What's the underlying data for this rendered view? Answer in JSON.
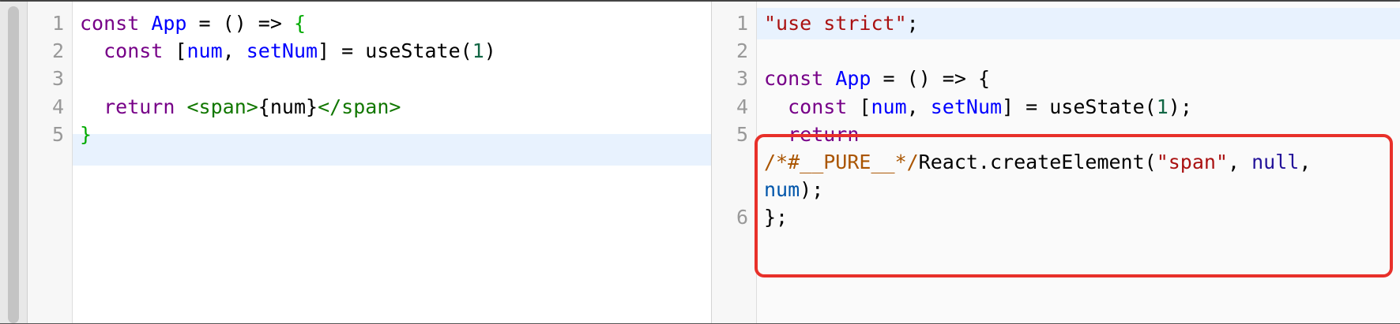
{
  "left_editor": {
    "lines": [
      {
        "n": "1",
        "tokens": [
          {
            "t": "const",
            "c": "kw"
          },
          {
            "t": " ",
            "c": "plain"
          },
          {
            "t": "App",
            "c": "def"
          },
          {
            "t": " = () => ",
            "c": "plain"
          },
          {
            "t": "{",
            "c": "br"
          }
        ]
      },
      {
        "n": "2",
        "tokens": [
          {
            "t": "  const",
            "c": "kw"
          },
          {
            "t": " [",
            "c": "plain"
          },
          {
            "t": "num",
            "c": "def"
          },
          {
            "t": ", ",
            "c": "plain"
          },
          {
            "t": "setNum",
            "c": "def"
          },
          {
            "t": "] = useState(",
            "c": "plain"
          },
          {
            "t": "1",
            "c": "nm"
          },
          {
            "t": ")",
            "c": "plain"
          }
        ]
      },
      {
        "n": "3",
        "tokens": []
      },
      {
        "n": "4",
        "tokens": [
          {
            "t": "  return",
            "c": "kw"
          },
          {
            "t": " ",
            "c": "plain"
          },
          {
            "t": "<span>",
            "c": "tag"
          },
          {
            "t": "{num}",
            "c": "plain"
          },
          {
            "t": "</span>",
            "c": "tag"
          }
        ]
      },
      {
        "n": "5",
        "tokens": [
          {
            "t": "}",
            "c": "br"
          }
        ]
      }
    ]
  },
  "right_editor": {
    "lines": [
      {
        "n": "1",
        "tokens": [
          {
            "t": "\"use strict\"",
            "c": "str"
          },
          {
            "t": ";",
            "c": "plain"
          }
        ]
      },
      {
        "n": "2",
        "tokens": []
      },
      {
        "n": "3",
        "tokens": [
          {
            "t": "const",
            "c": "kw"
          },
          {
            "t": " ",
            "c": "plain"
          },
          {
            "t": "App",
            "c": "def"
          },
          {
            "t": " = () => {",
            "c": "plain"
          }
        ]
      },
      {
        "n": "4",
        "tokens": [
          {
            "t": "  const",
            "c": "kw"
          },
          {
            "t": " [",
            "c": "plain"
          },
          {
            "t": "num",
            "c": "def"
          },
          {
            "t": ", ",
            "c": "plain"
          },
          {
            "t": "setNum",
            "c": "def"
          },
          {
            "t": "] = useState(",
            "c": "plain"
          },
          {
            "t": "1",
            "c": "nm"
          },
          {
            "t": ");",
            "c": "plain"
          }
        ]
      },
      {
        "n": "5",
        "tokens": [
          {
            "t": "  return",
            "c": "kw"
          }
        ]
      },
      {
        "n": "",
        "tokens": [
          {
            "t": "/*#__PURE__*/",
            "c": "cmt"
          },
          {
            "t": "React.createElement(",
            "c": "plain"
          },
          {
            "t": "\"span\"",
            "c": "str"
          },
          {
            "t": ", ",
            "c": "plain"
          },
          {
            "t": "null",
            "c": "atom"
          },
          {
            "t": ",",
            "c": "plain"
          }
        ]
      },
      {
        "n": "",
        "tokens": [
          {
            "t": "num",
            "c": "var"
          },
          {
            "t": ");",
            "c": "plain"
          }
        ]
      },
      {
        "n": "6",
        "tokens": [
          {
            "t": "};",
            "c": "plain"
          }
        ]
      }
    ]
  },
  "colors": {
    "highlight_box": "#e8302a",
    "active_line": "#e8f2fe"
  }
}
